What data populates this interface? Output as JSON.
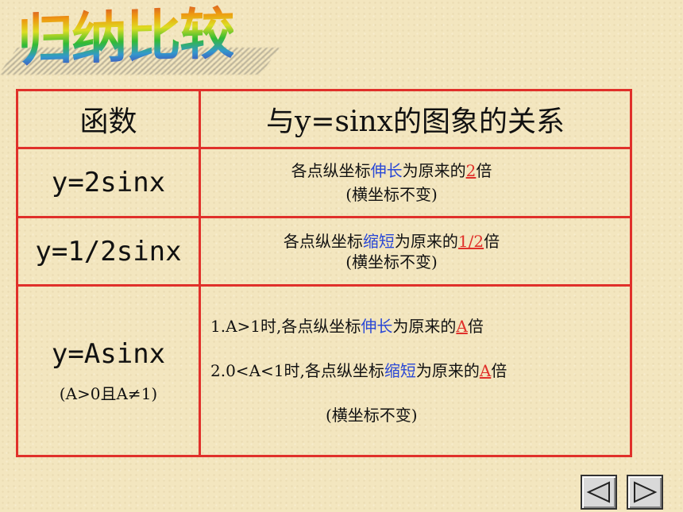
{
  "title": "归纳比较",
  "table": {
    "header": {
      "col1": "函数",
      "col2": "与y=sinx的图象的关系"
    },
    "rows": [
      {
        "func": "y=2sinx",
        "line1": {
          "pre": "各点纵坐标",
          "hl": "伸长",
          "mid": "为原来的",
          "val": "2",
          "post": "倍"
        },
        "line2": "(横坐标不变)"
      },
      {
        "func": "y=1/2sinx",
        "line1": {
          "pre": "各点纵坐标",
          "hl": "缩短",
          "mid": "为原来的",
          "val": "1/2",
          "post": "倍"
        },
        "line2": "(横坐标不变)"
      },
      {
        "func": "y=Asinx",
        "cond": "(A>0且A≠1)",
        "item1": {
          "pre": "1.A>1时,各点纵坐标",
          "hl": "伸长",
          "mid": "为原来的",
          "val": "A",
          "post": "倍"
        },
        "item2": {
          "pre": "2.0<A<1时,各点纵坐标",
          "hl": "缩短",
          "mid": "为原来的",
          "val": "A",
          "post": "倍"
        },
        "note": "(横坐标不变)"
      }
    ]
  },
  "colors": {
    "border": "#e0302a",
    "highlight": "#2a48d6",
    "value": "#e0302a"
  },
  "nav": {
    "prev": "arrow-left-icon",
    "next": "arrow-right-icon"
  }
}
